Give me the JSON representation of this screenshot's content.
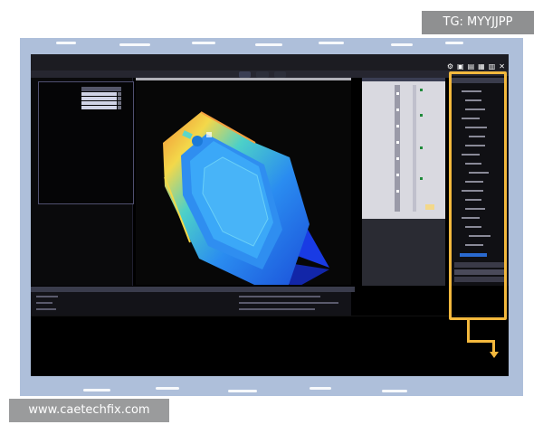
{
  "watermark_top": "TG: MYYJJPP",
  "watermark_bottom": "www.caetechfix.com",
  "colors": {
    "frame_background": "#aebfda",
    "highlight": "#f3b83d",
    "screen_background": "#000000",
    "part_gradient": [
      "#f08a34",
      "#f3d84a",
      "#4cd0c8",
      "#2a8cf0",
      "#1a4cd8"
    ]
  }
}
